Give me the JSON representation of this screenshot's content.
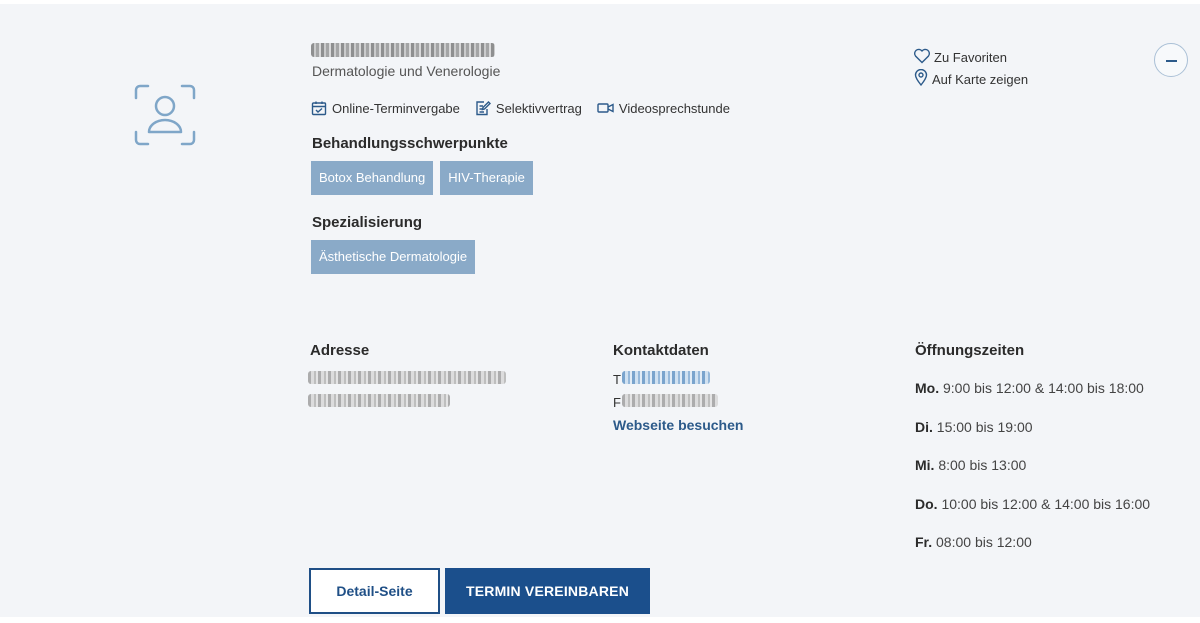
{
  "doctor": {
    "specialty": "Dermatologie und Venerologie"
  },
  "features": [
    {
      "icon": "calendar-check-icon",
      "label": "Online-Terminvergabe"
    },
    {
      "icon": "edit-document-icon",
      "label": "Selektivvertrag"
    },
    {
      "icon": "video-camera-icon",
      "label": "Videosprechstunde"
    }
  ],
  "focus": {
    "title": "Behandlungsschwerpunkte",
    "tags": [
      "Botox Behandlung",
      "HIV-Therapie"
    ]
  },
  "specialization": {
    "title": "Spezialisierung",
    "tags": [
      "Ästhetische Dermatologie"
    ]
  },
  "actions": {
    "favorite": "Zu Favoriten",
    "map": "Auf Karte zeigen"
  },
  "address": {
    "title": "Adresse"
  },
  "contact": {
    "title": "Kontaktdaten",
    "phone_prefix": "T",
    "fax_prefix": "F",
    "website": "Webseite besuchen"
  },
  "hours": {
    "title": "Öffnungszeiten",
    "rows": [
      {
        "day": "Mo.",
        "time": "9:00 bis 12:00 & 14:00 bis 18:00"
      },
      {
        "day": "Di.",
        "time": "15:00 bis 19:00"
      },
      {
        "day": "Mi.",
        "time": "8:00 bis 13:00"
      },
      {
        "day": "Do.",
        "time": "10:00 bis 12:00 & 14:00 bis 16:00"
      },
      {
        "day": "Fr.",
        "time": "08:00 bis 12:00"
      }
    ]
  },
  "buttons": {
    "detail": "Detail-Seite",
    "appointment": "TERMIN VEREINBAREN"
  },
  "colors": {
    "accent": "#1b4f8c",
    "tag": "#8aaac8",
    "card_bg": "#f3f5f8"
  }
}
